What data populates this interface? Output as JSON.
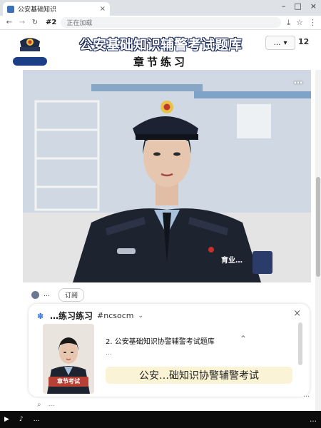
{
  "browser": {
    "tab_title": "公安基础知识",
    "tab_close": "×",
    "win_min": "–",
    "win_max": "□",
    "win_close": "×",
    "back": "←",
    "forward": "→",
    "reload": "↻",
    "tab_number": "#2",
    "address_text": "正在加载",
    "download_icon": "⤓",
    "star_icon": "☆",
    "menu_icon": "⋮"
  },
  "header": {
    "logo_caption": "考…题库",
    "title": "公安基础知识辅警考试题库",
    "section": "章节练习",
    "select_label": "…",
    "select_chevron": "▾",
    "page_indicator": "12"
  },
  "video": {
    "watermark": "…",
    "name_badge": "育业…"
  },
  "channel": {
    "name": "…",
    "subscribe": "订阅"
  },
  "card": {
    "header_title": "…练习练习",
    "header_tag": "#ncsocm",
    "header_chevron": "⌄",
    "close": "×",
    "thumb_label": "章节考试",
    "item_title": "2. 公安基础知识协警辅警考试题库",
    "item_sub": "…",
    "item_up": "⌃",
    "banner": "公安…础知识协警辅警考试",
    "footer_text": "…"
  },
  "peek": {
    "icon": "⌕",
    "text": "…"
  },
  "taskbar": {
    "item1": "▶",
    "item2": "♪",
    "item3": "…",
    "clock": "…"
  },
  "colors": {
    "uniform": "#1e2330",
    "shirt": "#a9c0da",
    "skin": "#e7c6b0",
    "background_wall": "#c9d3df",
    "brand_blue": "#3b6fb6",
    "banner": "#fbf3d6",
    "badge_red": "#b64134"
  }
}
